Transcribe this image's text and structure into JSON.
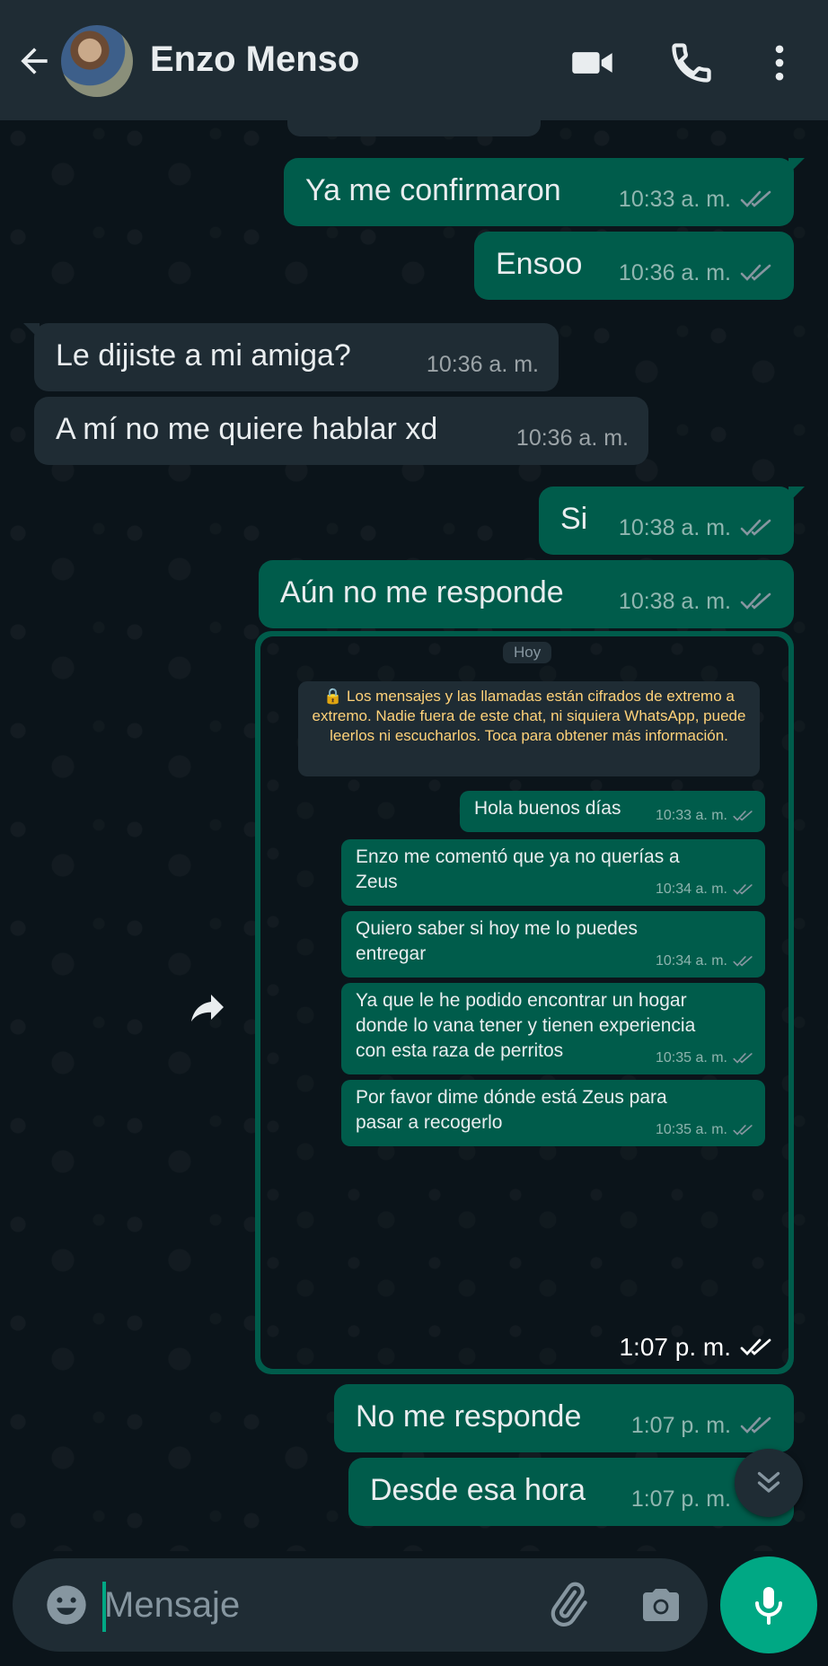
{
  "header": {
    "contact_name": "Enzo Menso"
  },
  "messages": [
    {
      "text": "Ya me confirmaron",
      "time": "10:33 a. m.",
      "dir": "out"
    },
    {
      "text": "Ensoo",
      "time": "10:36 a. m.",
      "dir": "out"
    },
    {
      "text": "Le dijiste a mi amiga?",
      "time": "10:36 a. m.",
      "dir": "in"
    },
    {
      "text": "A mí no me quiere hablar xd",
      "time": "10:36 a. m.",
      "dir": "in"
    },
    {
      "text": "Si",
      "time": "10:38 a. m.",
      "dir": "out"
    },
    {
      "text": "Aún no me responde",
      "time": "10:38 a. m.",
      "dir": "out"
    },
    {
      "text": "No me responde",
      "time": "1:07 p. m.",
      "dir": "out"
    },
    {
      "text": "Desde esa hora",
      "time": "1:07 p. m.",
      "dir": "out"
    }
  ],
  "image_message": {
    "time": "1:07 p. m.",
    "screenshot": {
      "day_label": "Hoy",
      "notice": "🔒 Los mensajes y las llamadas están cifrados de extremo a extremo. Nadie fuera de este chat, ni siquiera WhatsApp, puede leerlos ni escucharlos. Toca para obtener más información.",
      "messages": [
        {
          "text": "Hola buenos días",
          "time": "10:33 a. m."
        },
        {
          "text": "Enzo me comentó que ya no querías a\nZeus",
          "time": "10:34 a. m."
        },
        {
          "text": "Quiero saber si hoy me lo puedes\nentregar",
          "time": "10:34 a. m."
        },
        {
          "text": "Ya que le he podido encontrar un hogar\ndonde lo vana tener y tienen experiencia\ncon esta raza de perritos",
          "time": "10:35 a. m."
        },
        {
          "text": "Por favor dime dónde está Zeus para\npasar a recogerlo",
          "time": "10:35 a. m."
        }
      ]
    }
  },
  "composer": {
    "placeholder": "Mensaje"
  },
  "colors": {
    "outgoing_bubble": "#005c4b",
    "incoming_bubble": "#1f2c34",
    "accent": "#00a884",
    "header": "#1f2c34",
    "read_ticks": "#8696a0",
    "notice_text": "#ffd279"
  },
  "icons": [
    "back-arrow-icon",
    "video-call-icon",
    "phone-icon",
    "more-vert-icon",
    "share-icon",
    "double-chevron-down-icon",
    "emoji-icon",
    "attach-icon",
    "camera-icon",
    "mic-icon",
    "read-ticks-icon",
    "lock-icon"
  ]
}
